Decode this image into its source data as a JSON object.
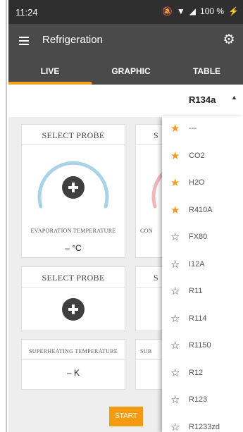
{
  "status_bar": {
    "time": "11:24",
    "battery": "100 %"
  },
  "toolbar": {
    "title": "Refrigeration"
  },
  "tabs": [
    {
      "label": "LIVE",
      "active": true
    },
    {
      "label": "GRAPHIC",
      "active": false
    },
    {
      "label": "TABLE",
      "active": false
    }
  ],
  "refrigerant": {
    "selected": "R134a"
  },
  "cards": {
    "top_left": {
      "title": "SELECT PROBE",
      "caption": "Evaporation temperature",
      "value": "– °C"
    },
    "top_right": {
      "title": "S",
      "caption": "Con"
    },
    "mid_left": {
      "title": "SELECT PROBE"
    },
    "mid_right": {
      "title": "S"
    },
    "bottom_left": {
      "caption": "Superheating temperature",
      "value": "– K"
    },
    "bottom_right": {
      "caption": "Sub"
    }
  },
  "start_button": "START",
  "dropdown": {
    "items": [
      {
        "label": "---",
        "favorite": true
      },
      {
        "label": "CO2",
        "favorite": true
      },
      {
        "label": "H2O",
        "favorite": true
      },
      {
        "label": "R410A",
        "favorite": true
      },
      {
        "label": "FX80",
        "favorite": false
      },
      {
        "label": "I12A",
        "favorite": false
      },
      {
        "label": "R11",
        "favorite": false
      },
      {
        "label": "R114",
        "favorite": false
      },
      {
        "label": "R1150",
        "favorite": false
      },
      {
        "label": "R12",
        "favorite": false
      },
      {
        "label": "R123",
        "favorite": false
      },
      {
        "label": "R1233zd",
        "favorite": false
      }
    ]
  },
  "colors": {
    "accent": "#f4a020",
    "toolbar": "#4a4a4a",
    "gauge_blue": "#a9d3e6",
    "gauge_red": "#f0b8bc"
  }
}
